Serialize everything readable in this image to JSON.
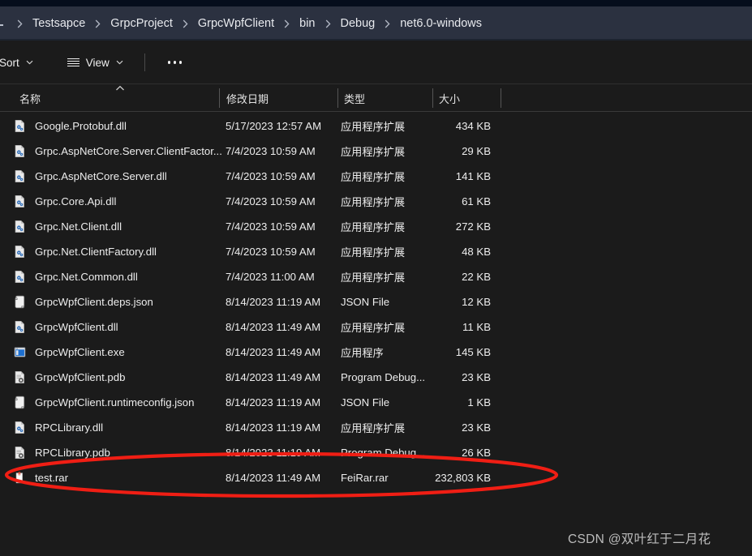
{
  "window": {
    "theme_background": "#1b1b1b",
    "address_bar_background": "#2b3140",
    "accent_annotation_color": "#f01e14"
  },
  "breadcrumb": {
    "name": "address-breadcrumb",
    "items": [
      {
        "label": "Testsapce"
      },
      {
        "label": "GrpcProject"
      },
      {
        "label": "GrpcWpfClient"
      },
      {
        "label": "bin"
      },
      {
        "label": "Debug"
      },
      {
        "label": "net6.0-windows"
      }
    ]
  },
  "toolbar": {
    "sort_label": "Sort",
    "view_label": "View",
    "overflow_label": "See more"
  },
  "columns": {
    "name": "名称",
    "date_modified": "修改日期",
    "type": "类型",
    "size": "大小",
    "sort_column": "名称",
    "sort_direction": "ascending"
  },
  "files": [
    {
      "name": "Google.Protobuf.dll",
      "date": "5/17/2023 12:57 AM",
      "type": "应用程序扩展",
      "size": "434 KB",
      "icon": "dll-icon"
    },
    {
      "name": "Grpc.AspNetCore.Server.ClientFactor...",
      "date": "7/4/2023 10:59 AM",
      "type": "应用程序扩展",
      "size": "29 KB",
      "icon": "dll-icon"
    },
    {
      "name": "Grpc.AspNetCore.Server.dll",
      "date": "7/4/2023 10:59 AM",
      "type": "应用程序扩展",
      "size": "141 KB",
      "icon": "dll-icon"
    },
    {
      "name": "Grpc.Core.Api.dll",
      "date": "7/4/2023 10:59 AM",
      "type": "应用程序扩展",
      "size": "61 KB",
      "icon": "dll-icon"
    },
    {
      "name": "Grpc.Net.Client.dll",
      "date": "7/4/2023 10:59 AM",
      "type": "应用程序扩展",
      "size": "272 KB",
      "icon": "dll-icon"
    },
    {
      "name": "Grpc.Net.ClientFactory.dll",
      "date": "7/4/2023 10:59 AM",
      "type": "应用程序扩展",
      "size": "48 KB",
      "icon": "dll-icon"
    },
    {
      "name": "Grpc.Net.Common.dll",
      "date": "7/4/2023 11:00 AM",
      "type": "应用程序扩展",
      "size": "22 KB",
      "icon": "dll-icon"
    },
    {
      "name": "GrpcWpfClient.deps.json",
      "date": "8/14/2023 11:19 AM",
      "type": "JSON File",
      "size": "12 KB",
      "icon": "json-icon"
    },
    {
      "name": "GrpcWpfClient.dll",
      "date": "8/14/2023 11:49 AM",
      "type": "应用程序扩展",
      "size": "11 KB",
      "icon": "dll-icon"
    },
    {
      "name": "GrpcWpfClient.exe",
      "date": "8/14/2023 11:49 AM",
      "type": "应用程序",
      "size": "145 KB",
      "icon": "exe-icon"
    },
    {
      "name": "GrpcWpfClient.pdb",
      "date": "8/14/2023 11:49 AM",
      "type": "Program Debug...",
      "size": "23 KB",
      "icon": "pdb-icon"
    },
    {
      "name": "GrpcWpfClient.runtimeconfig.json",
      "date": "8/14/2023 11:19 AM",
      "type": "JSON File",
      "size": "1 KB",
      "icon": "json-icon"
    },
    {
      "name": "RPCLibrary.dll",
      "date": "8/14/2023 11:19 AM",
      "type": "应用程序扩展",
      "size": "23 KB",
      "icon": "dll-icon"
    },
    {
      "name": "RPCLibrary.pdb",
      "date": "8/14/2023 11:19 AM",
      "type": "Program Debug...",
      "size": "26 KB",
      "icon": "pdb-icon"
    },
    {
      "name": "test.rar",
      "date": "8/14/2023 11:49 AM",
      "type": "FeiRar.rar",
      "size": "232,803 KB",
      "icon": "rar-icon"
    }
  ],
  "annotation": {
    "shape": "ellipse",
    "target_file": "test.rar",
    "color": "#f01e14"
  },
  "watermark": {
    "text": "CSDN @双叶红于二月花"
  }
}
